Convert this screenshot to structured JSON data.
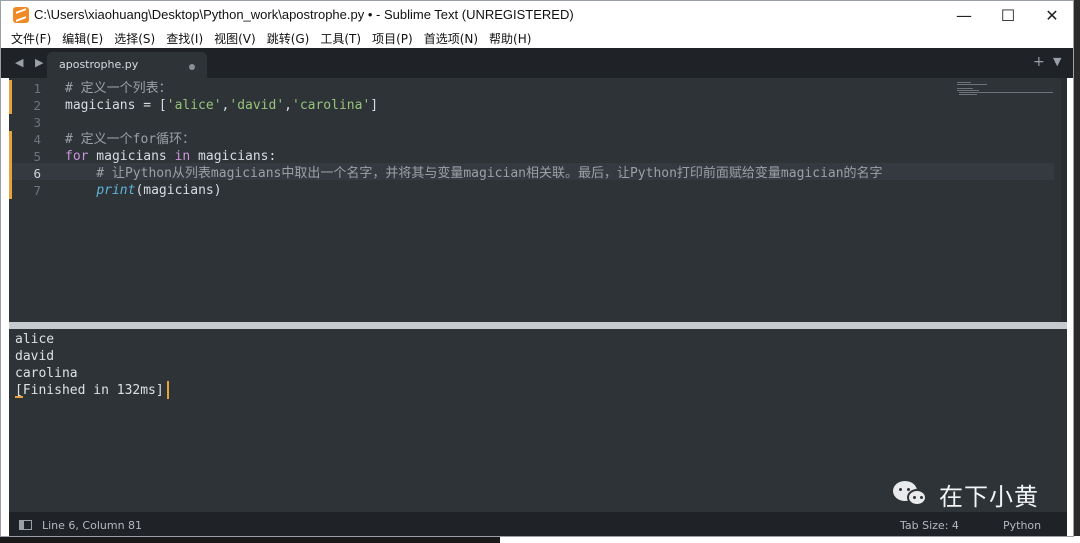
{
  "window": {
    "title": "C:\\Users\\xiaohuang\\Desktop\\Python_work\\apostrophe.py • - Sublime Text (UNREGISTERED)",
    "controls": {
      "minimize": "—",
      "maximize": "☐",
      "close": "✕"
    }
  },
  "menu": [
    "文件(F)",
    "编辑(E)",
    "选择(S)",
    "查找(I)",
    "视图(V)",
    "跳转(G)",
    "工具(T)",
    "项目(P)",
    "首选项(N)",
    "帮助(H)"
  ],
  "tabs": {
    "nav": "◀ ▶",
    "active": {
      "label": "apostrophe.py",
      "modified": true
    },
    "new_tab": "+",
    "overflow": "▼"
  },
  "editor": {
    "line_numbers": [
      "1",
      "2",
      "3",
      "4",
      "5",
      "6",
      "7"
    ],
    "active_line": 6,
    "lines": [
      [
        {
          "t": "# 定义一个列表：",
          "c": "comment"
        }
      ],
      [
        {
          "t": "magicians = [",
          "c": "punct"
        },
        {
          "t": "'alice'",
          "c": "string"
        },
        {
          "t": ",",
          "c": "punct"
        },
        {
          "t": "'david'",
          "c": "string"
        },
        {
          "t": ",",
          "c": "punct"
        },
        {
          "t": "'carolina'",
          "c": "string"
        },
        {
          "t": "]",
          "c": "punct"
        }
      ],
      [],
      [
        {
          "t": "# 定义一个for循环：",
          "c": "comment"
        }
      ],
      [
        {
          "t": "for",
          "c": "keyword"
        },
        {
          "t": " magicians ",
          "c": "punct"
        },
        {
          "t": "in",
          "c": "keyword"
        },
        {
          "t": " magicians:",
          "c": "punct"
        }
      ],
      [
        {
          "t": "    # 让Python从列表magicians中取出一个名字，并将其与变量magician相关联。最后，让Python打印前面赋给变量magician的名字",
          "c": "comment"
        }
      ],
      [
        {
          "t": "    ",
          "c": "punct"
        },
        {
          "t": "print",
          "c": "func"
        },
        {
          "t": "(magicians)",
          "c": "punct"
        }
      ]
    ]
  },
  "output": {
    "lines": [
      "alice",
      "david",
      "carolina",
      "[Finished in 132ms]"
    ]
  },
  "watermark": {
    "text": "在下小黄",
    "icon": "wechat-icon"
  },
  "status": {
    "position": "Line 6, Column 81",
    "tab_size": "Tab Size: 4",
    "syntax": "Python"
  },
  "colors": {
    "editor_bg": "#2e3338",
    "tabbar_bg": "#1f2227",
    "string": "#97c279",
    "keyword": "#c694d7",
    "function": "#5fb4d6",
    "comment": "#9aa0a8",
    "accent": "#e8a23c"
  }
}
